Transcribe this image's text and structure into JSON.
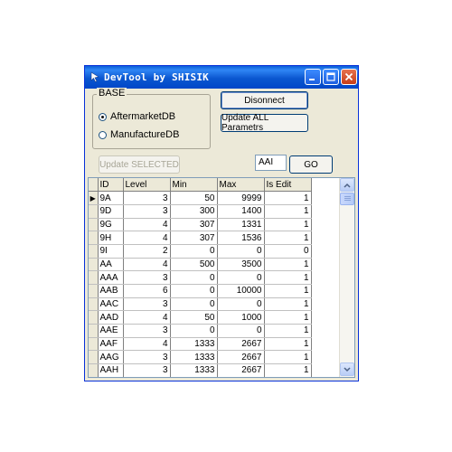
{
  "window": {
    "title": "DevTool by SHISIK"
  },
  "base_group": {
    "label": "BASE",
    "options": [
      {
        "label": "AftermarketDB",
        "selected": true
      },
      {
        "label": "ManufactureDB",
        "selected": false
      }
    ]
  },
  "buttons": {
    "disconnect": "Disonnect",
    "update_all": "Update ALL Parametrs",
    "update_selected": "Update SELECTED",
    "go": "GO"
  },
  "search": {
    "value": "AAI"
  },
  "grid": {
    "columns": [
      "ID",
      "Level",
      "Min",
      "Max",
      "Is Edit"
    ],
    "rows": [
      [
        "9A",
        "3",
        "50",
        "9999",
        "1"
      ],
      [
        "9D",
        "3",
        "300",
        "1400",
        "1"
      ],
      [
        "9G",
        "4",
        "307",
        "1331",
        "1"
      ],
      [
        "9H",
        "4",
        "307",
        "1536",
        "1"
      ],
      [
        "9I",
        "2",
        "0",
        "0",
        "0"
      ],
      [
        "AA",
        "4",
        "500",
        "3500",
        "1"
      ],
      [
        "AAA",
        "3",
        "0",
        "0",
        "1"
      ],
      [
        "AAB",
        "6",
        "0",
        "10000",
        "1"
      ],
      [
        "AAC",
        "3",
        "0",
        "0",
        "1"
      ],
      [
        "AAD",
        "4",
        "50",
        "1000",
        "1"
      ],
      [
        "AAE",
        "3",
        "0",
        "0",
        "1"
      ],
      [
        "AAF",
        "4",
        "1333",
        "2667",
        "1"
      ],
      [
        "AAG",
        "3",
        "1333",
        "2667",
        "1"
      ],
      [
        "AAH",
        "3",
        "1333",
        "2667",
        "1"
      ]
    ],
    "current_row_marker": "▶"
  },
  "icons": {
    "minimize": "minimize-icon",
    "maximize": "maximize-icon",
    "close": "close-icon",
    "scroll_up": "chevron-up-icon",
    "scroll_down": "chevron-down-icon"
  },
  "colors": {
    "titlebar": "#0b57d0",
    "window_bg": "#ece9d8",
    "close_button": "#c83d18"
  }
}
